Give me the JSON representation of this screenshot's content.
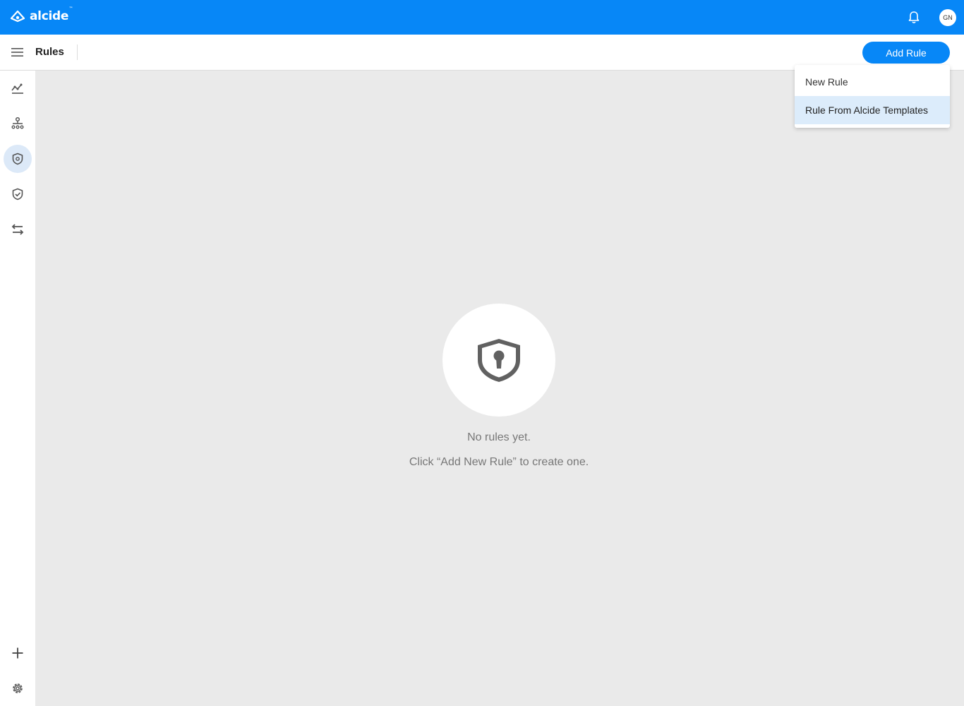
{
  "app": {
    "logo_text": "alcide",
    "logo_tm": "™",
    "user_initials": "GN"
  },
  "header": {
    "title": "Rules",
    "add_rule_label": "Add Rule"
  },
  "dropdown": {
    "items": [
      {
        "label": "New Rule"
      },
      {
        "label": "Rule From Alcide Templates"
      }
    ]
  },
  "sidebar": {
    "items": [
      {
        "icon": "analytics-icon"
      },
      {
        "icon": "topology-icon"
      },
      {
        "icon": "rules-shield-icon",
        "active": true
      },
      {
        "icon": "compliance-shield-icon"
      },
      {
        "icon": "transfer-icon"
      },
      {
        "icon": "plus-icon"
      },
      {
        "icon": "settings-icon"
      }
    ]
  },
  "empty_state": {
    "title": "No rules yet.",
    "subtitle": "Click “Add New Rule” to create one."
  },
  "colors": {
    "brand": "#0787f7",
    "active_bg": "#dce9f8",
    "hover_bg": "#dcecfb",
    "canvas_bg": "#eaeaea"
  }
}
